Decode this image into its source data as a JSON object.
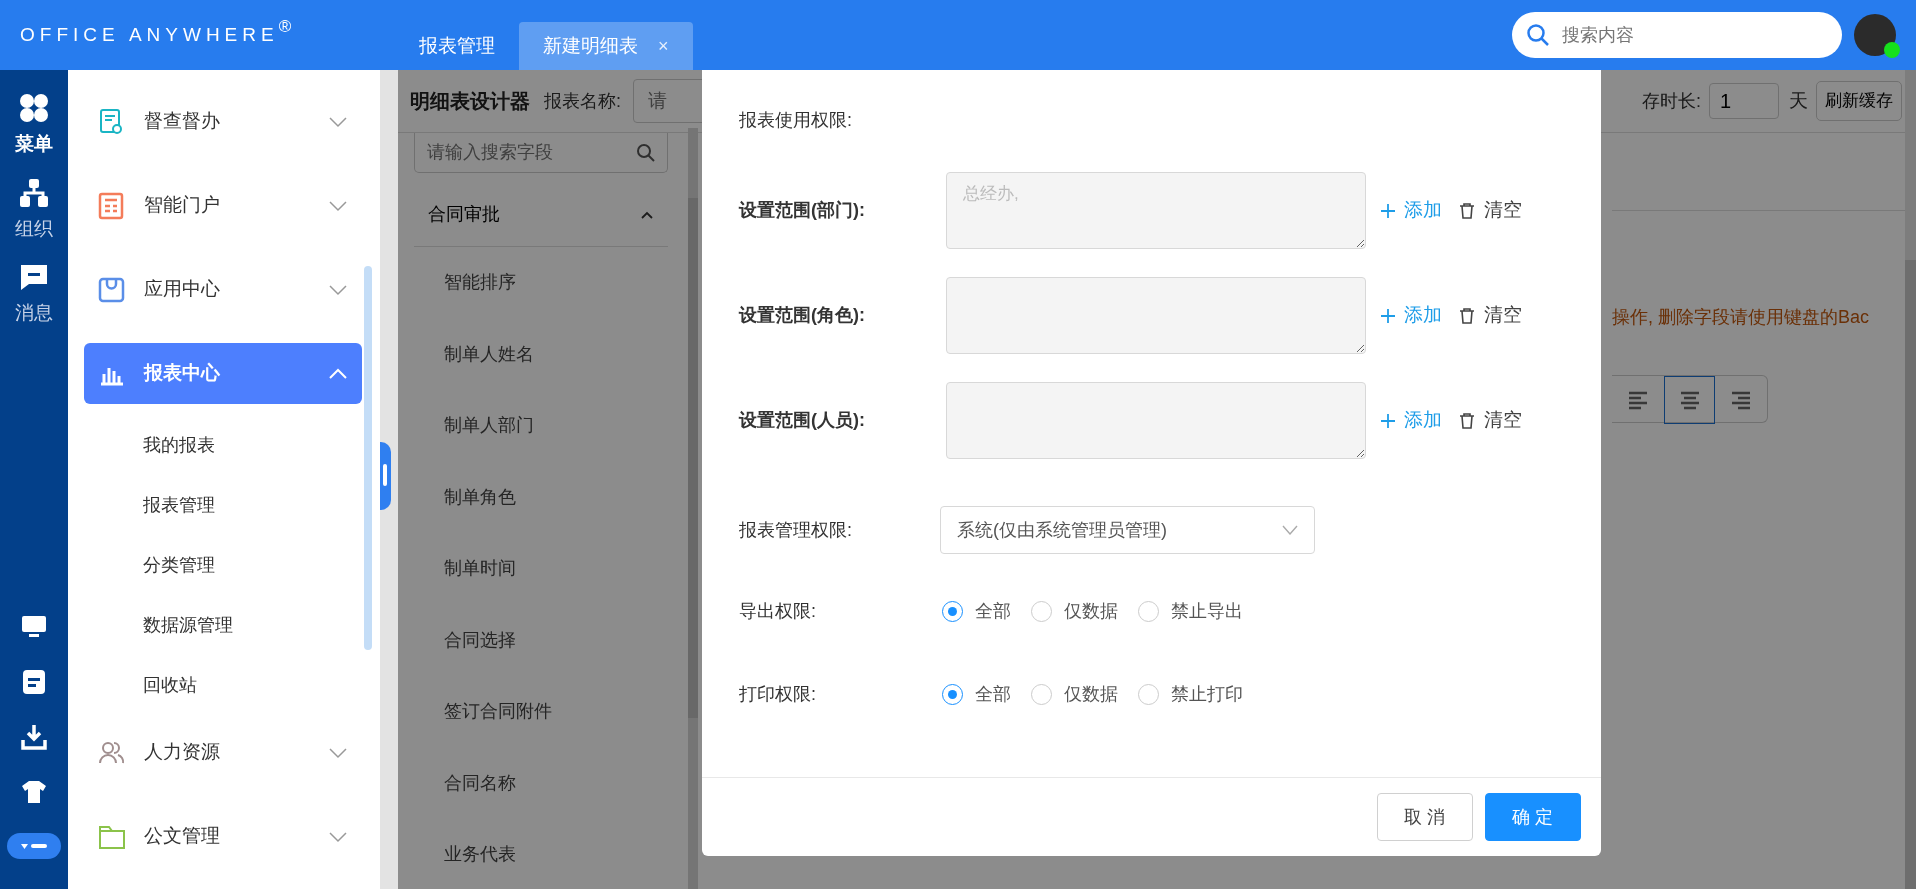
{
  "header": {
    "logo": "OFFICE ANYWHERE",
    "logo_mark": "®",
    "tabs": [
      {
        "label": "报表管理",
        "selected": false
      },
      {
        "label": "新建明细表",
        "selected": true,
        "close": "×"
      }
    ],
    "search": {
      "placeholder": "搜索内容"
    },
    "avatar": {
      "online": true
    }
  },
  "rail": {
    "items": [
      {
        "label": "菜单",
        "selected": true
      },
      {
        "label": "组织",
        "selected": false
      },
      {
        "label": "消息",
        "selected": false
      }
    ]
  },
  "sidebar": {
    "items": [
      {
        "label": "督查督办",
        "selected": false,
        "expanded": false
      },
      {
        "label": "智能门户",
        "selected": false,
        "expanded": false
      },
      {
        "label": "应用中心",
        "selected": false,
        "expanded": false
      },
      {
        "label": "报表中心",
        "selected": true,
        "expanded": true,
        "children": [
          {
            "label": "我的报表"
          },
          {
            "label": "报表管理"
          },
          {
            "label": "分类管理"
          },
          {
            "label": "数据源管理"
          },
          {
            "label": "回收站"
          }
        ]
      },
      {
        "label": "人力资源",
        "selected": false,
        "expanded": false
      },
      {
        "label": "公文管理",
        "selected": false,
        "expanded": false
      }
    ]
  },
  "designer": {
    "title": "明细表设计器",
    "name_label": "报表名称:",
    "name_placeholder": "请",
    "cache_label": "存时长:",
    "cache_value": "1",
    "cache_unit": "天",
    "refresh_button": "刷新缓存",
    "field_search": {
      "placeholder": "请输入搜索字段"
    },
    "field_group": {
      "label": "合同审批",
      "expanded": true,
      "fields": [
        "智能排序",
        "制单人姓名",
        "制单人部门",
        "制单角色",
        "制单时间",
        "合同选择",
        "签订合同附件",
        "合同名称",
        "业务代表"
      ]
    },
    "hint": "操作, 删除字段请使用键盘的Bac",
    "align_buttons": [
      {
        "kind": "left",
        "selected": false
      },
      {
        "kind": "center",
        "selected": true
      },
      {
        "kind": "right",
        "selected": false
      }
    ]
  },
  "modal": {
    "section_label": "报表使用权限:",
    "scopes": [
      {
        "label": "设置范围(部门):",
        "value": "总经办,",
        "add": "添加",
        "clear": "清空"
      },
      {
        "label": "设置范围(角色):",
        "add": "添加",
        "clear": "清空"
      },
      {
        "label": "设置范围(人员):",
        "add": "添加",
        "clear": "清空"
      }
    ],
    "manage": {
      "label": "报表管理权限:",
      "value": "系统(仅由系统管理员管理)"
    },
    "radio_groups": [
      {
        "label": "导出权限:",
        "options": [
          {
            "label": "全部",
            "selected": true
          },
          {
            "label": "仅数据",
            "selected": false
          },
          {
            "label": "禁止导出",
            "selected": false
          }
        ]
      },
      {
        "label": "打印权限:",
        "options": [
          {
            "label": "全部",
            "selected": true
          },
          {
            "label": "仅数据",
            "selected": false
          },
          {
            "label": "禁止打印",
            "selected": false
          }
        ]
      }
    ],
    "buttons": [
      {
        "label": "取 消",
        "kind": "default"
      },
      {
        "label": "确 定",
        "kind": "primary"
      }
    ]
  }
}
